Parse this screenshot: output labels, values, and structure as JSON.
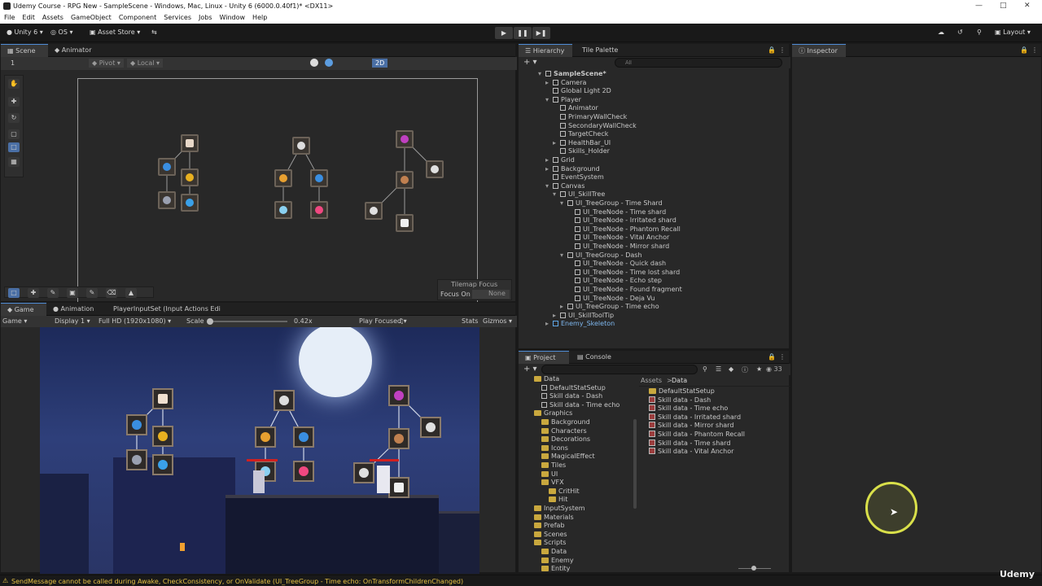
{
  "window": {
    "title": "Udemy Course - RPG New - SampleScene - Windows, Mac, Linux - Unity 6 (6000.0.40f1)* <DX11>"
  },
  "menu": [
    "File",
    "Edit",
    "Assets",
    "GameObject",
    "Component",
    "Services",
    "Jobs",
    "Window",
    "Help"
  ],
  "toolbar": {
    "account": "Unity 6",
    "os": "OS",
    "asset_store": "Asset Store",
    "layout": "Layout"
  },
  "scene": {
    "tab_scene": "Scene",
    "tab_animator": "Animator",
    "layer_num": "1",
    "pivot": "Pivot",
    "local": "Local",
    "mode2d": "2D",
    "tilemap_focus": "Tilemap Focus",
    "focus_on": "Focus On",
    "focus_value": "None"
  },
  "game": {
    "tab_game": "Game",
    "tab_animation": "Animation",
    "tab_input": "PlayerInputSet (Input Actions Edi",
    "display_type": "Game",
    "display": "Display 1",
    "resolution": "Full HD (1920x1080)",
    "scale_label": "Scale",
    "scale_value": "0.42x",
    "play_focused": "Play Focused",
    "stats": "Stats",
    "gizmos": "Gizmos"
  },
  "hierarchy": {
    "tab_hierarchy": "Hierarchy",
    "tab_tile": "Tile Palette",
    "search_placeholder": "All",
    "items": [
      {
        "label": "SampleScene*",
        "d": 0
      },
      {
        "label": "Camera",
        "d": 1
      },
      {
        "label": "Global Light 2D",
        "d": 1
      },
      {
        "label": "Player",
        "d": 1
      },
      {
        "label": "Animator",
        "d": 2
      },
      {
        "label": "PrimaryWallCheck",
        "d": 2
      },
      {
        "label": "SecondaryWallCheck",
        "d": 2
      },
      {
        "label": "TargetCheck",
        "d": 2
      },
      {
        "label": "HealthBar_UI",
        "d": 2
      },
      {
        "label": "Skills_Holder",
        "d": 2
      },
      {
        "label": "Grid",
        "d": 1
      },
      {
        "label": "Background",
        "d": 1
      },
      {
        "label": "EventSystem",
        "d": 1
      },
      {
        "label": "Canvas",
        "d": 1
      },
      {
        "label": "UI_SkillTree",
        "d": 2
      },
      {
        "label": "UI_TreeGroup - Time Shard",
        "d": 3
      },
      {
        "label": "UI_TreeNode - Time shard",
        "d": 4
      },
      {
        "label": "UI_TreeNode - Irritated shard",
        "d": 4
      },
      {
        "label": "UI_TreeNode - Phantom Recall",
        "d": 4
      },
      {
        "label": "UI_TreeNode - Vital Anchor",
        "d": 4
      },
      {
        "label": "UI_TreeNode - Mirror shard",
        "d": 4
      },
      {
        "label": "UI_TreeGroup - Dash",
        "d": 3
      },
      {
        "label": "UI_TreeNode - Quick dash",
        "d": 4
      },
      {
        "label": "UI_TreeNode - Time lost shard",
        "d": 4
      },
      {
        "label": "UI_TreeNode - Echo step",
        "d": 4
      },
      {
        "label": "UI_TreeNode - Found fragment",
        "d": 4
      },
      {
        "label": "UI_TreeNode - Deja Vu",
        "d": 4
      },
      {
        "label": "UI_TreeGroup - Time echo",
        "d": 3
      },
      {
        "label": "UI_SkillToolTip",
        "d": 2
      },
      {
        "label": "Enemy_Skeleton",
        "d": 1
      }
    ]
  },
  "inspector": {
    "tab": "Inspector"
  },
  "project": {
    "tab_project": "Project",
    "tab_console": "Console",
    "count": "33",
    "breadcrumb": [
      "Assets",
      "Data"
    ],
    "tree": [
      {
        "label": "Data",
        "d": 1
      },
      {
        "label": "DefaultStatSetup",
        "d": 2
      },
      {
        "label": "Skill data - Dash",
        "d": 2
      },
      {
        "label": "Skill data - Time echo",
        "d": 2
      },
      {
        "label": "Graphics",
        "d": 1
      },
      {
        "label": "Background",
        "d": 2
      },
      {
        "label": "Characters",
        "d": 2
      },
      {
        "label": "Decorations",
        "d": 2
      },
      {
        "label": "Icons",
        "d": 2
      },
      {
        "label": "MagicalEffect",
        "d": 2
      },
      {
        "label": "Tiles",
        "d": 2
      },
      {
        "label": "UI",
        "d": 2
      },
      {
        "label": "VFX",
        "d": 2
      },
      {
        "label": "CritHit",
        "d": 3
      },
      {
        "label": "Hit",
        "d": 3
      },
      {
        "label": "InputSystem",
        "d": 1
      },
      {
        "label": "Materials",
        "d": 1
      },
      {
        "label": "Prefab",
        "d": 1
      },
      {
        "label": "Scenes",
        "d": 1
      },
      {
        "label": "Scripts",
        "d": 1
      },
      {
        "label": "Data",
        "d": 2
      },
      {
        "label": "Enemy",
        "d": 2
      },
      {
        "label": "Entity",
        "d": 2
      }
    ],
    "assets": [
      "DefaultStatSetup",
      "Skill data - Dash",
      "Skill data - Time echo",
      "Skill data - Irritated shard",
      "Skill data - Mirror shard",
      "Skill data - Phantom Recall",
      "Skill data - Time shard",
      "Skill data - Vital Anchor"
    ]
  },
  "status": {
    "message": "SendMessage cannot be called during Awake, CheckConsistency, or OnValidate (UI_TreeGroup - Time echo: OnTransformChildrenChanged)"
  },
  "watermark": "Udemy",
  "colors": {
    "accent": "#4f8cd6",
    "warning": "#e5c144",
    "cursor_ring": "#d9e04a"
  }
}
